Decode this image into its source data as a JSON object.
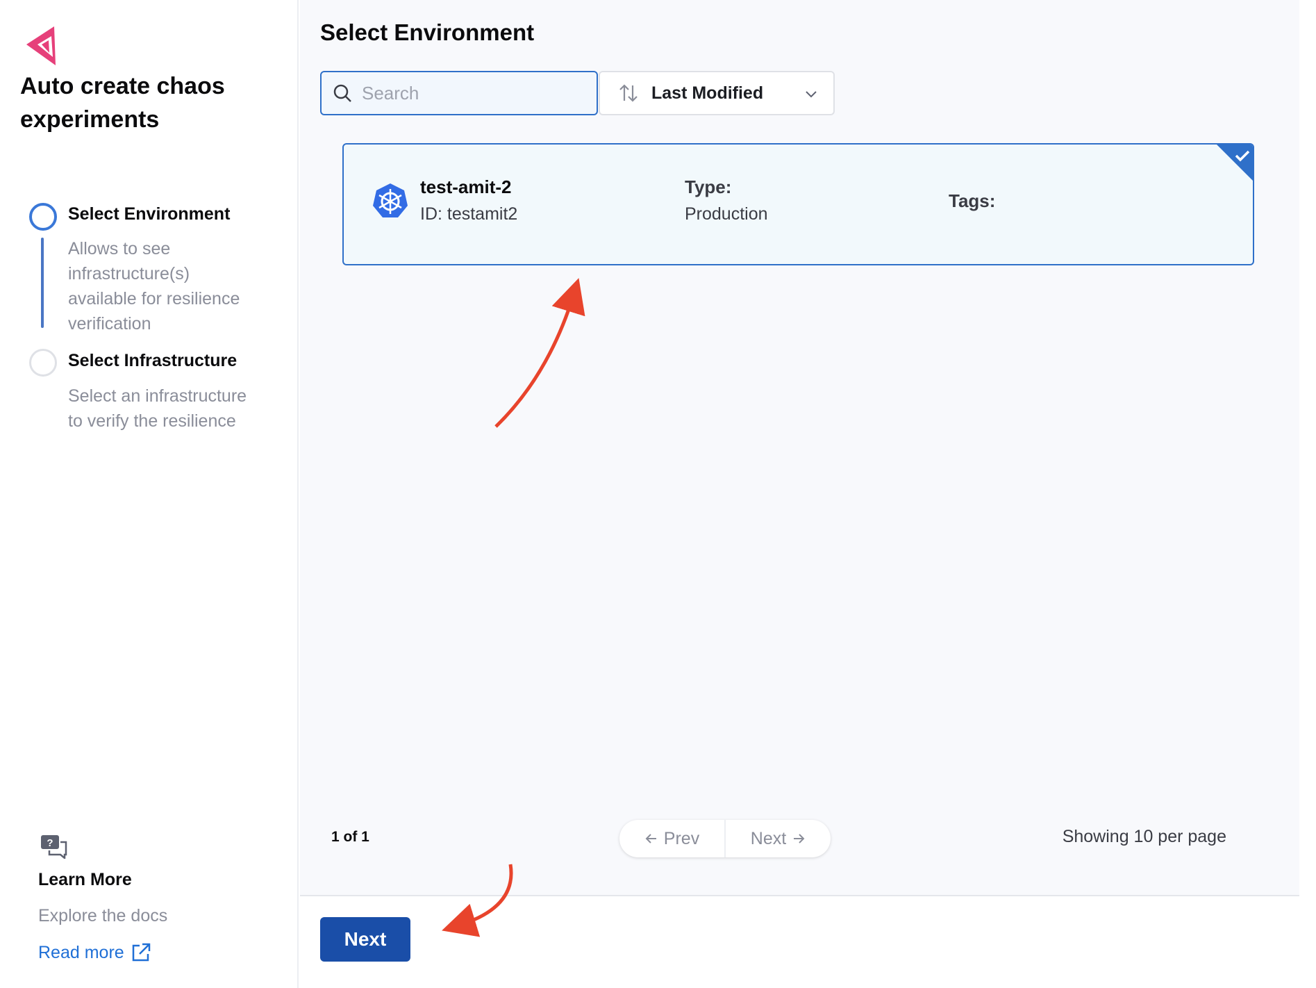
{
  "sidebar": {
    "title": "Auto create chaos experiments",
    "steps": [
      {
        "label": "Select Environment",
        "description": "Allows to see infrastructure(s) available for resilience verification",
        "active": true
      },
      {
        "label": "Select Infrastructure",
        "description": "Select an infrastructure to verify the resilience",
        "active": false
      }
    ],
    "learn_more": {
      "title": "Learn More",
      "description": "Explore the docs",
      "link": "Read more"
    }
  },
  "main": {
    "title": "Select Environment",
    "search": {
      "placeholder": "Search",
      "value": ""
    },
    "sort": {
      "selected": "Last Modified"
    },
    "environments": [
      {
        "name": "test-amit-2",
        "id_text": "ID: testamit2",
        "type_label": "Type:",
        "type_value": "Production",
        "tags_label": "Tags:",
        "selected": true
      }
    ],
    "pagination": {
      "page_count": "1 of 1",
      "prev_label": "Prev",
      "next_label": "Next",
      "per_page": "Showing 10 per page"
    }
  },
  "footer": {
    "next_label": "Next"
  },
  "colors": {
    "accent": "#2f70c9",
    "primary_button": "#1a4ea8",
    "brand": "#e6407a",
    "annotation_arrow": "#e8442c"
  },
  "icons": [
    "harness-chaos-logo-icon",
    "search-icon",
    "sort-icon",
    "chevron-down-icon",
    "check-icon",
    "kubernetes-icon",
    "arrow-left-icon",
    "arrow-right-icon",
    "help-chat-icon",
    "external-link-icon"
  ]
}
